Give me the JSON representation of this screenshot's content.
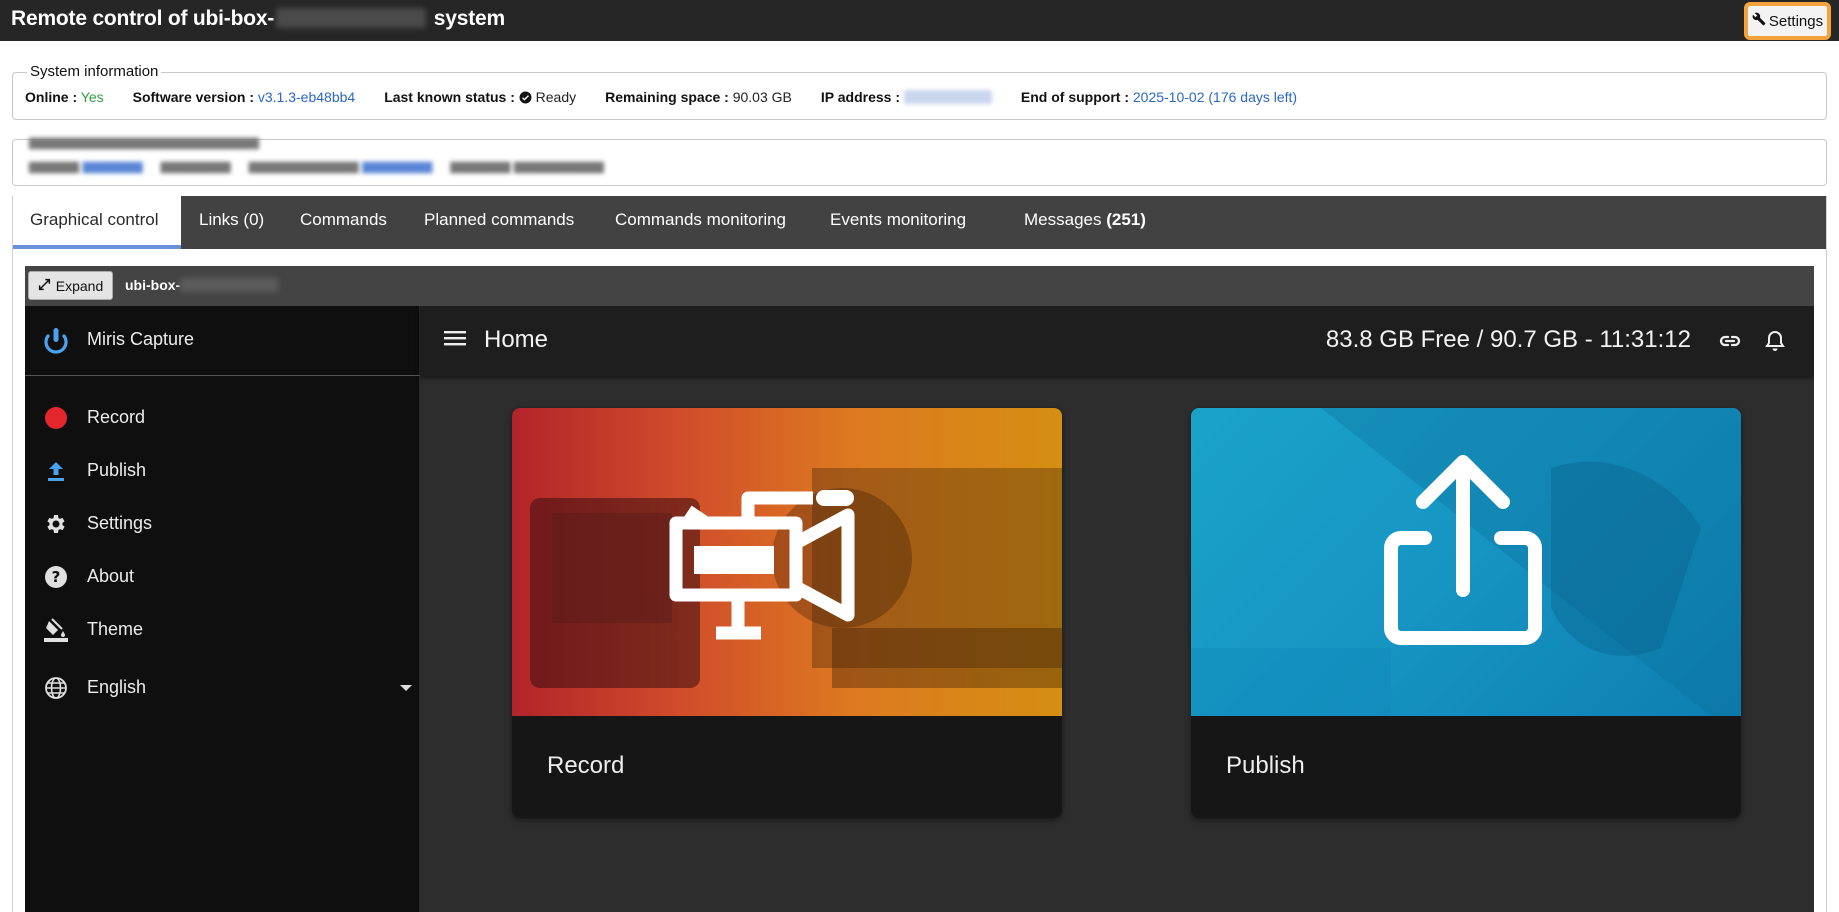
{
  "header": {
    "title_prefix": "Remote control of ubi-box-",
    "title_suffix": " system",
    "settings_label": "Settings"
  },
  "system_info": {
    "legend": "System information",
    "online_label": "Online :",
    "online_value": "Yes",
    "version_label": "Software version :",
    "version_value": "v3.1.3-eb48bb4",
    "status_label": "Last known status :",
    "status_value": "Ready",
    "space_label": "Remaining space :",
    "space_value": "90.03 GB",
    "ip_label": "IP address :",
    "support_label": "End of support :",
    "support_value": "2025-10-02 (176 days left)"
  },
  "tabs": [
    {
      "label": "Graphical control"
    },
    {
      "label": "Links (0)"
    },
    {
      "label": "Commands"
    },
    {
      "label": "Planned commands"
    },
    {
      "label": "Commands monitoring"
    },
    {
      "label": "Events monitoring"
    },
    {
      "label": "Messages ",
      "count": "(251)"
    }
  ],
  "remote": {
    "expand_label": "Expand",
    "name_prefix": "ubi-box-"
  },
  "app": {
    "brand": "Miris Capture",
    "nav": [
      {
        "label": "Record",
        "icon": "record-dot-icon"
      },
      {
        "label": "Publish",
        "icon": "upload-icon"
      },
      {
        "label": "Settings",
        "icon": "gear-icon"
      },
      {
        "label": "About",
        "icon": "help-icon"
      },
      {
        "label": "Theme",
        "icon": "paint-bucket-icon"
      },
      {
        "label": "English",
        "icon": "globe-icon"
      }
    ],
    "page_title": "Home",
    "storage": "83.8 GB Free / 90.7 GB - 11:31:12",
    "cards": [
      {
        "label": "Record"
      },
      {
        "label": "Publish"
      }
    ]
  },
  "colors": {
    "accent": "#f5a23d",
    "tab_underline": "#6a8fdc",
    "record_red": "#e3262b",
    "publish_blue": "#4aa3f0"
  }
}
